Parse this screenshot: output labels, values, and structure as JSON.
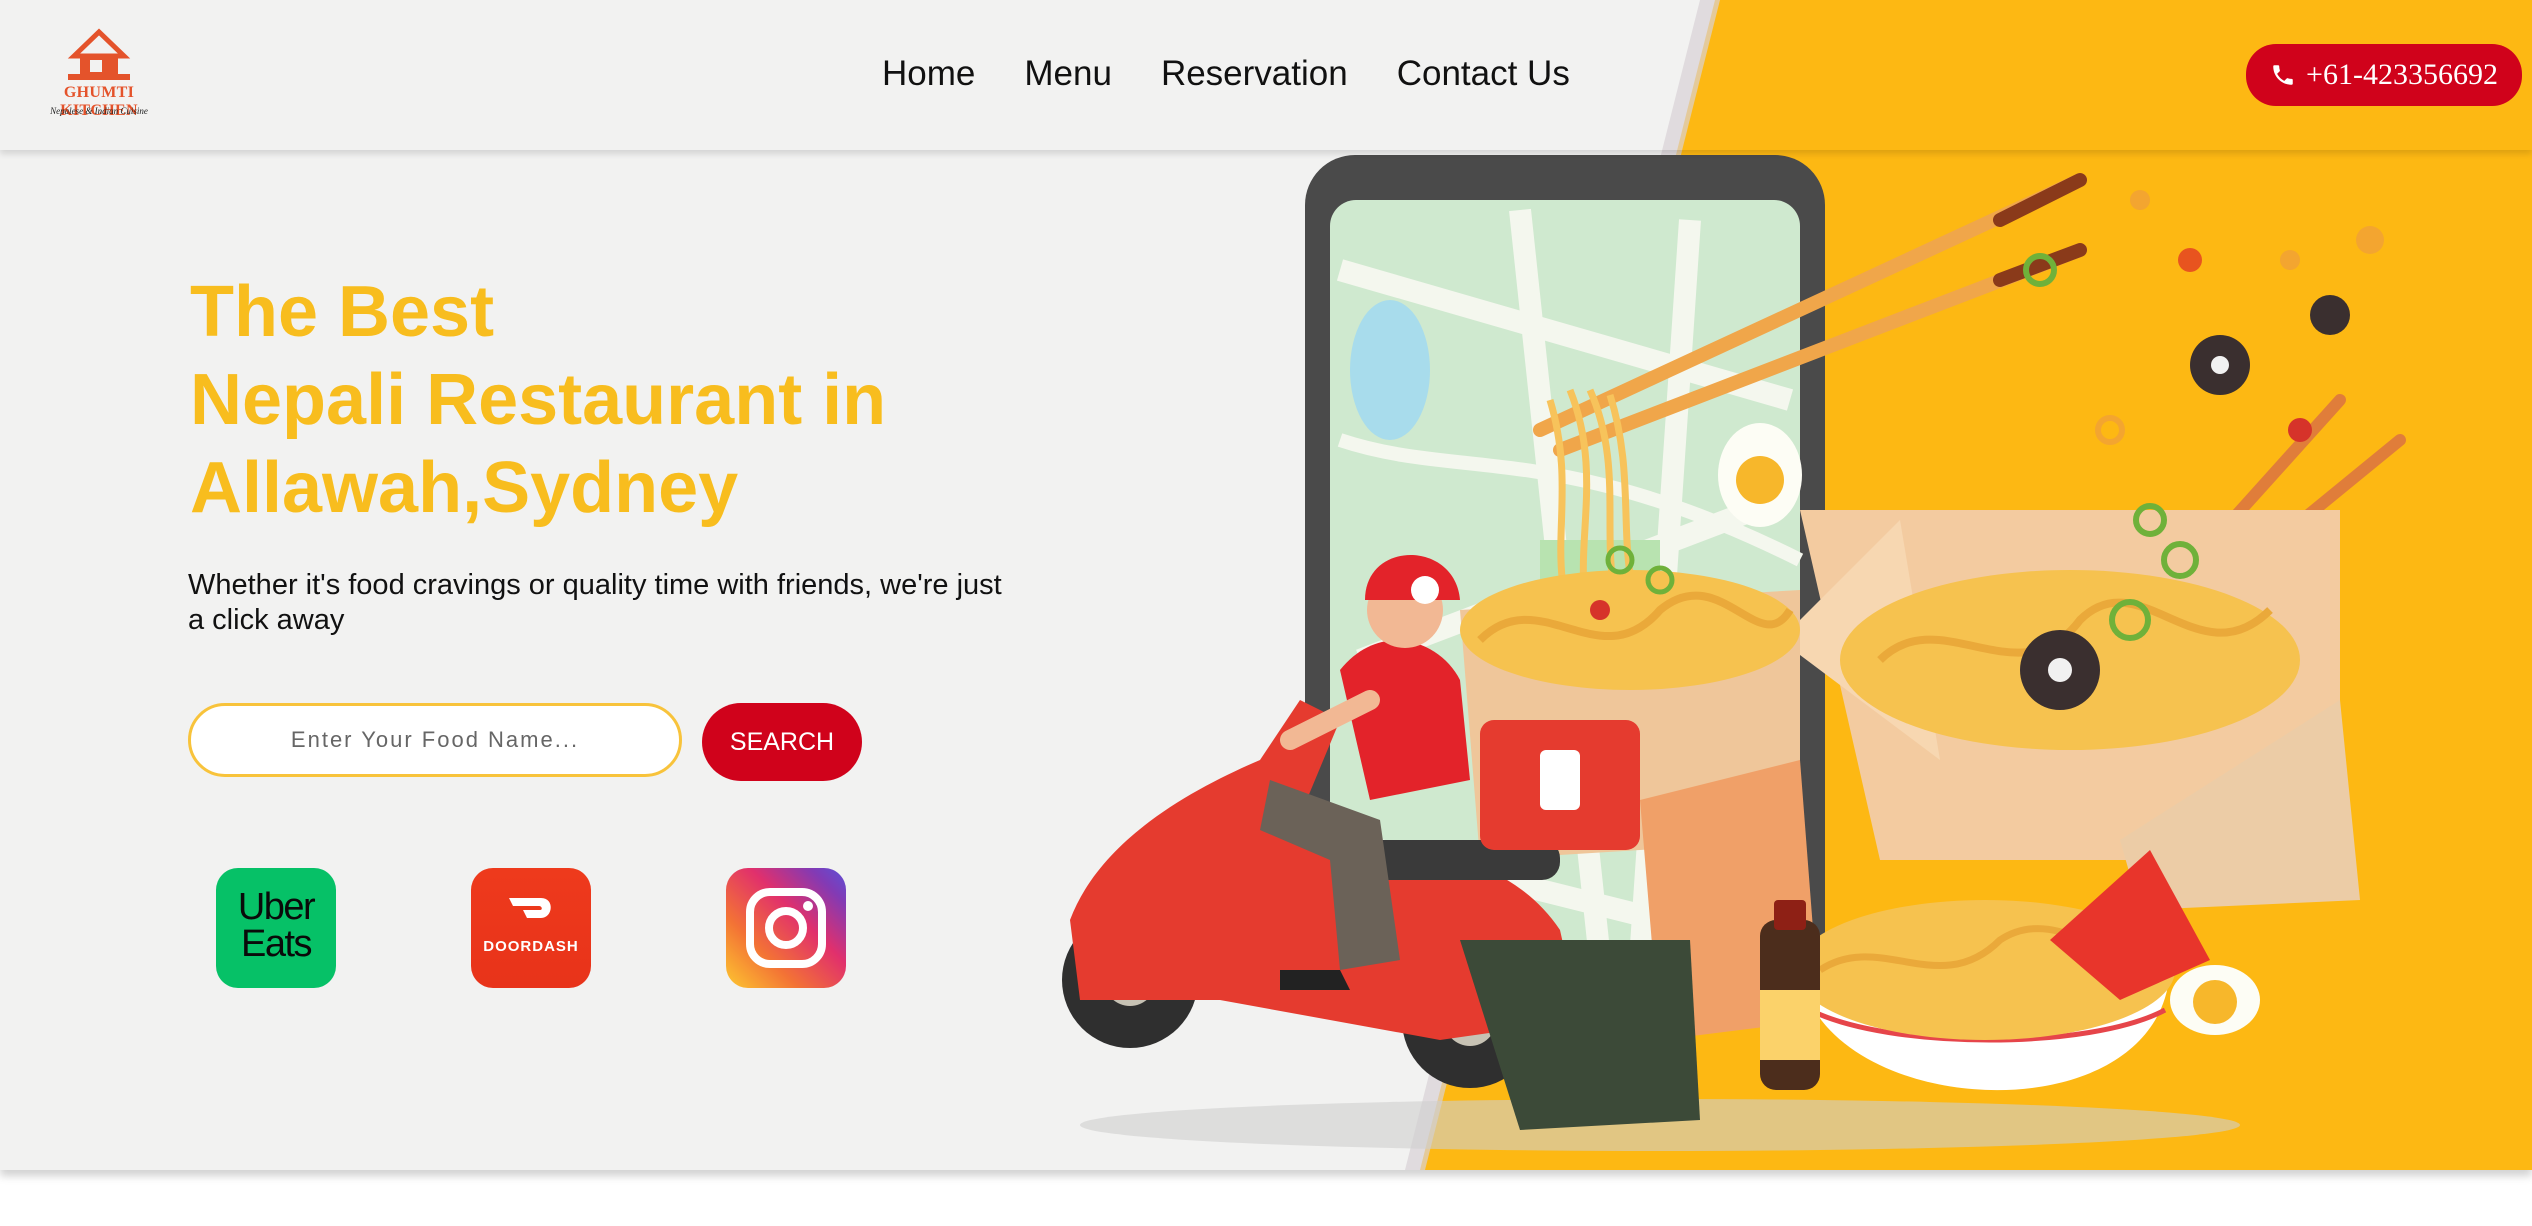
{
  "brand": {
    "name": "GHUMTI KITCHEN",
    "tagline": "Nepalese & Indian Cuisine",
    "primary_color": "#d0021b",
    "accent_color": "#f8bd1e",
    "background_yellow": "#fdb813"
  },
  "nav": {
    "items": [
      {
        "label": "Home"
      },
      {
        "label": "Menu"
      },
      {
        "label": "Reservation"
      },
      {
        "label": "Contact Us"
      }
    ],
    "phone_icon": "phone-icon",
    "phone": "+61-423356692"
  },
  "hero": {
    "title_lines": [
      "The Best",
      "Nepali Restaurant in",
      "Allawah,Sydney"
    ],
    "subtitle": "Whether it's food cravings or quality time with friends, we're just a click away"
  },
  "search": {
    "placeholder": "Enter Your Food Name...",
    "button_label": "SEARCH"
  },
  "apps": {
    "uber_eats": {
      "line1": "Uber",
      "line2": "Eats"
    },
    "doordash": {
      "label": "DOORDASH"
    },
    "instagram": {
      "icon": "instagram-icon"
    }
  },
  "illustration": {
    "subject": "delivery-scooter-with-noodle-boxes-and-phone-map"
  }
}
